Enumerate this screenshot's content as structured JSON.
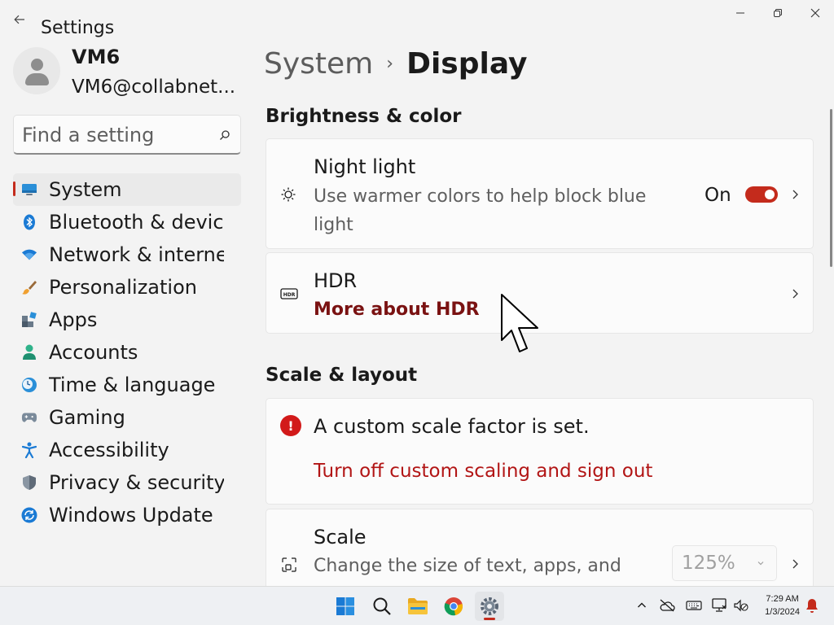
{
  "window": {
    "app_title": "Settings",
    "caption": {
      "minimize": "minimize-icon",
      "restore": "restore-icon",
      "close": "close-icon"
    }
  },
  "user": {
    "name": "VM6",
    "email": "VM6@collabnet..."
  },
  "search": {
    "placeholder": "Find a setting",
    "value": ""
  },
  "nav": {
    "items": [
      {
        "label": "System",
        "icon": "monitor-icon",
        "selected": true
      },
      {
        "label": "Bluetooth & devices",
        "icon": "bluetooth-icon",
        "selected": false
      },
      {
        "label": "Network & internet",
        "icon": "wifi-icon",
        "selected": false
      },
      {
        "label": "Personalization",
        "icon": "brush-icon",
        "selected": false
      },
      {
        "label": "Apps",
        "icon": "apps-icon",
        "selected": false
      },
      {
        "label": "Accounts",
        "icon": "person-icon",
        "selected": false
      },
      {
        "label": "Time & language",
        "icon": "globe-clock-icon",
        "selected": false
      },
      {
        "label": "Gaming",
        "icon": "gamepad-icon",
        "selected": false
      },
      {
        "label": "Accessibility",
        "icon": "accessibility-icon",
        "selected": false
      },
      {
        "label": "Privacy & security",
        "icon": "shield-icon",
        "selected": false
      },
      {
        "label": "Windows Update",
        "icon": "update-icon",
        "selected": false
      }
    ]
  },
  "breadcrumb": {
    "parent": "System",
    "separator": "›",
    "current": "Display"
  },
  "sections": {
    "brightness": {
      "title": "Brightness & color",
      "night_light": {
        "title": "Night light",
        "desc_line1": "Use warmer colors to help block blue",
        "desc_line2": "light",
        "toggle_label": "On",
        "toggle_on": true
      },
      "hdr": {
        "title": "HDR",
        "link": "More about HDR"
      }
    },
    "scale_layout": {
      "title": "Scale & layout",
      "warning": {
        "title": "A custom scale factor is set.",
        "link": "Turn off custom scaling and sign out"
      },
      "scale": {
        "title": "Scale",
        "desc": "Change the size of text, apps, and",
        "value": "125%"
      }
    }
  },
  "taskbar": {
    "apps": [
      "windows-start-icon",
      "search-icon",
      "file-explorer-icon",
      "chrome-icon",
      "settings-icon"
    ],
    "active_app": "settings-icon",
    "tray": [
      "chevron-up-icon",
      "onedrive-off-icon",
      "keyboard-icon",
      "network-icon",
      "volume-mute-icon",
      "notification-bell-icon"
    ],
    "time": "7:29 AM",
    "date": "1/3/2024"
  },
  "colors": {
    "accent": "#c42b1c",
    "link_dark": "#7a1212",
    "link_red": "#b21515",
    "error": "#d21a1a"
  }
}
